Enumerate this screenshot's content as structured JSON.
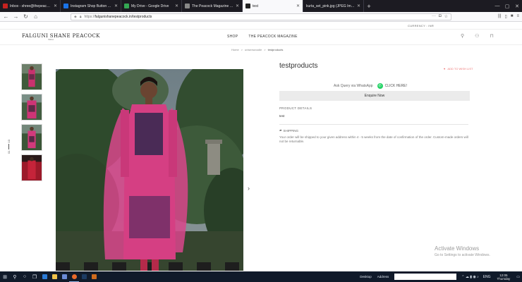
{
  "browser": {
    "tabs": [
      {
        "title": "Inbox - shree@thepeacockin...",
        "fav": "#c5221f",
        "active": false
      },
      {
        "title": "Instagram Shop Button - Goog...",
        "fav": "#1a73e8",
        "active": false
      },
      {
        "title": "My Drive - Google Drive",
        "fav": "#34a853",
        "active": false
      },
      {
        "title": "The Peacock Magazine by Falg...",
        "fav": "#888888",
        "active": false
      },
      {
        "title": "test",
        "fav": "#222222",
        "active": true
      },
      {
        "title": "kurta_set_pink.jpg (JPEG Image, 10...",
        "fav": "#444444",
        "active": false
      }
    ],
    "url_prefix": "https://",
    "url_main": "falgunishanepeacock.in/testproducts"
  },
  "site": {
    "currency": "CURRENCY : INR",
    "logo": "FALGUNI SHANE PEACOCK",
    "logo_sub": "INDIA",
    "nav": [
      "SHOP",
      "THE PEACOCK MAGAZINE"
    ]
  },
  "breadcrumb": {
    "home": "Home",
    "mid": "unisexwoodie",
    "current": "testproducts",
    "sep": ">"
  },
  "gallery": {
    "counter_current": "01",
    "counter_total": "10"
  },
  "product": {
    "title": "testproducts",
    "wishlist": "ADD TO WISH LIST",
    "ask_query": "Ask Query via WhatsApp",
    "click_here": "CLICK HERE!",
    "enquire": "Enquire Now",
    "details_label": "PRODUCT DETAILS",
    "details_value": "test",
    "shipping_label": "SHIPPING",
    "shipping_text": "Your order will be shipped to your given address within 4 - 5 weeks from the date of confirmation of the order. Custom-made orders will not be returnable."
  },
  "watermark": {
    "title": "Activate Windows",
    "subtitle": "Go to Settings to activate Windows."
  },
  "taskbar": {
    "desktop": "Desktop",
    "address": "Address",
    "lang": "ENG",
    "time": "12:05",
    "day": "Thursday"
  },
  "colors": {
    "accent_pink": "#e0427d",
    "wishlist": "#ee7777",
    "whatsapp": "#25d366"
  }
}
